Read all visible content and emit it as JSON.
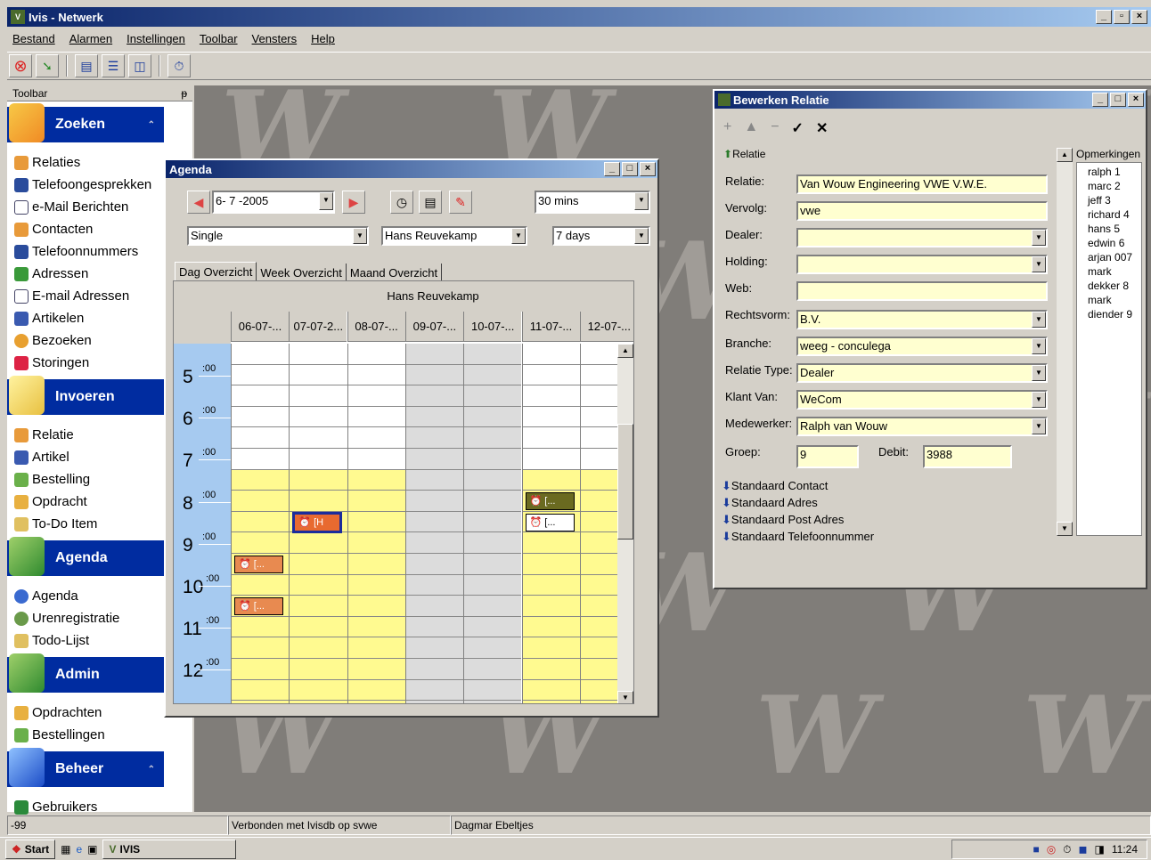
{
  "app": {
    "title": "Ivis - Netwerk"
  },
  "menu": [
    "Bestand",
    "Alarmen",
    "Instellingen",
    "Toolbar",
    "Vensters",
    "Help"
  ],
  "sidebar": {
    "header": "Toolbar",
    "pin": "ᵽ",
    "groups": [
      {
        "label": "Zoeken",
        "items": [
          "Relaties",
          "Telefoongesprekken",
          "e-Mail Berichten",
          "Contacten",
          "Telefoonnummers",
          "Adressen",
          "E-mail Adressen",
          "Artikelen",
          "Bezoeken",
          "Storingen"
        ]
      },
      {
        "label": "Invoeren",
        "items": [
          "Relatie",
          "Artikel",
          "Bestelling",
          "Opdracht",
          "To-Do Item"
        ]
      },
      {
        "label": "Agenda",
        "items": [
          "Agenda",
          "Urenregistratie",
          "Todo-Lijst"
        ]
      },
      {
        "label": "Admin",
        "items": [
          "Opdrachten",
          "Bestellingen"
        ]
      },
      {
        "label": "Beheer",
        "items": [
          "Gebruikers"
        ]
      }
    ]
  },
  "agenda": {
    "title": "Agenda",
    "date": "6- 7 -2005",
    "interval": "30 mins",
    "mode": "Single",
    "user": "Hans Reuvekamp",
    "range": "7 days",
    "tabs": [
      "Dag Overzicht",
      "Week Overzicht",
      "Maand Overzicht"
    ],
    "grid_title": "Hans Reuvekamp",
    "days": [
      "06-07-...",
      "07-07-2...",
      "08-07-...",
      "09-07-...",
      "10-07-...",
      "11-07-...",
      "12-07-..."
    ],
    "hours": [
      "5",
      "6",
      "7",
      "8",
      "9",
      "10",
      "11",
      "12"
    ],
    "minute_label": ":00",
    "appointments": [
      {
        "day": 0,
        "hour": 10.0,
        "text": "[..."
      },
      {
        "day": 0,
        "hour": 11.0,
        "text": "[..."
      },
      {
        "day": 1,
        "hour": 9.0,
        "text": "[H"
      },
      {
        "day": 5,
        "hour": 8.5,
        "text": "[..."
      },
      {
        "day": 5,
        "hour": 9.0,
        "text": "[..."
      }
    ]
  },
  "relatie": {
    "title": "Bewerken Relatie",
    "section": "Relatie",
    "fields": {
      "relatie_label": "Relatie:",
      "relatie": "Van Wouw Engineering  VWE  V.W.E.",
      "vervolg_label": "Vervolg:",
      "vervolg": "vwe",
      "dealer_label": "Dealer:",
      "dealer": "",
      "holding_label": "Holding:",
      "holding": "",
      "web_label": "Web:",
      "web": "",
      "rechtsvorm_label": "Rechtsvorm:",
      "rechtsvorm": "B.V.",
      "branche_label": "Branche:",
      "branche": "weeg - conculega",
      "relatietype_label": "Relatie Type:",
      "relatietype": "Dealer",
      "klantvan_label": "Klant Van:",
      "klantvan": "WeCom",
      "medewerker_label": "Medewerker:",
      "medewerker": "Ralph van Wouw",
      "groep_label": "Groep:",
      "groep": "9",
      "debit_label": "Debit:",
      "debit": "3988"
    },
    "collapsed": [
      "Standaard Contact",
      "Standaard Adres",
      "Standaard Post Adres",
      "Standaard Telefoonnummer"
    ],
    "opmerkingen_label": "Opmerkingen",
    "opmerkingen": [
      "ralph 1",
      "marc 2",
      "jeff   3",
      "richard 4",
      "hans 5",
      "edwin 6",
      "arjan 007",
      "mark",
      "dekker 8",
      "mark",
      "diender 9"
    ]
  },
  "status": {
    "left": "-99",
    "connection": "Verbonden met Ivisdb op svwe",
    "user": "Dagmar Ebeltjes"
  },
  "taskbar": {
    "start": "Start",
    "task": "IVIS",
    "clock": "11:24"
  }
}
